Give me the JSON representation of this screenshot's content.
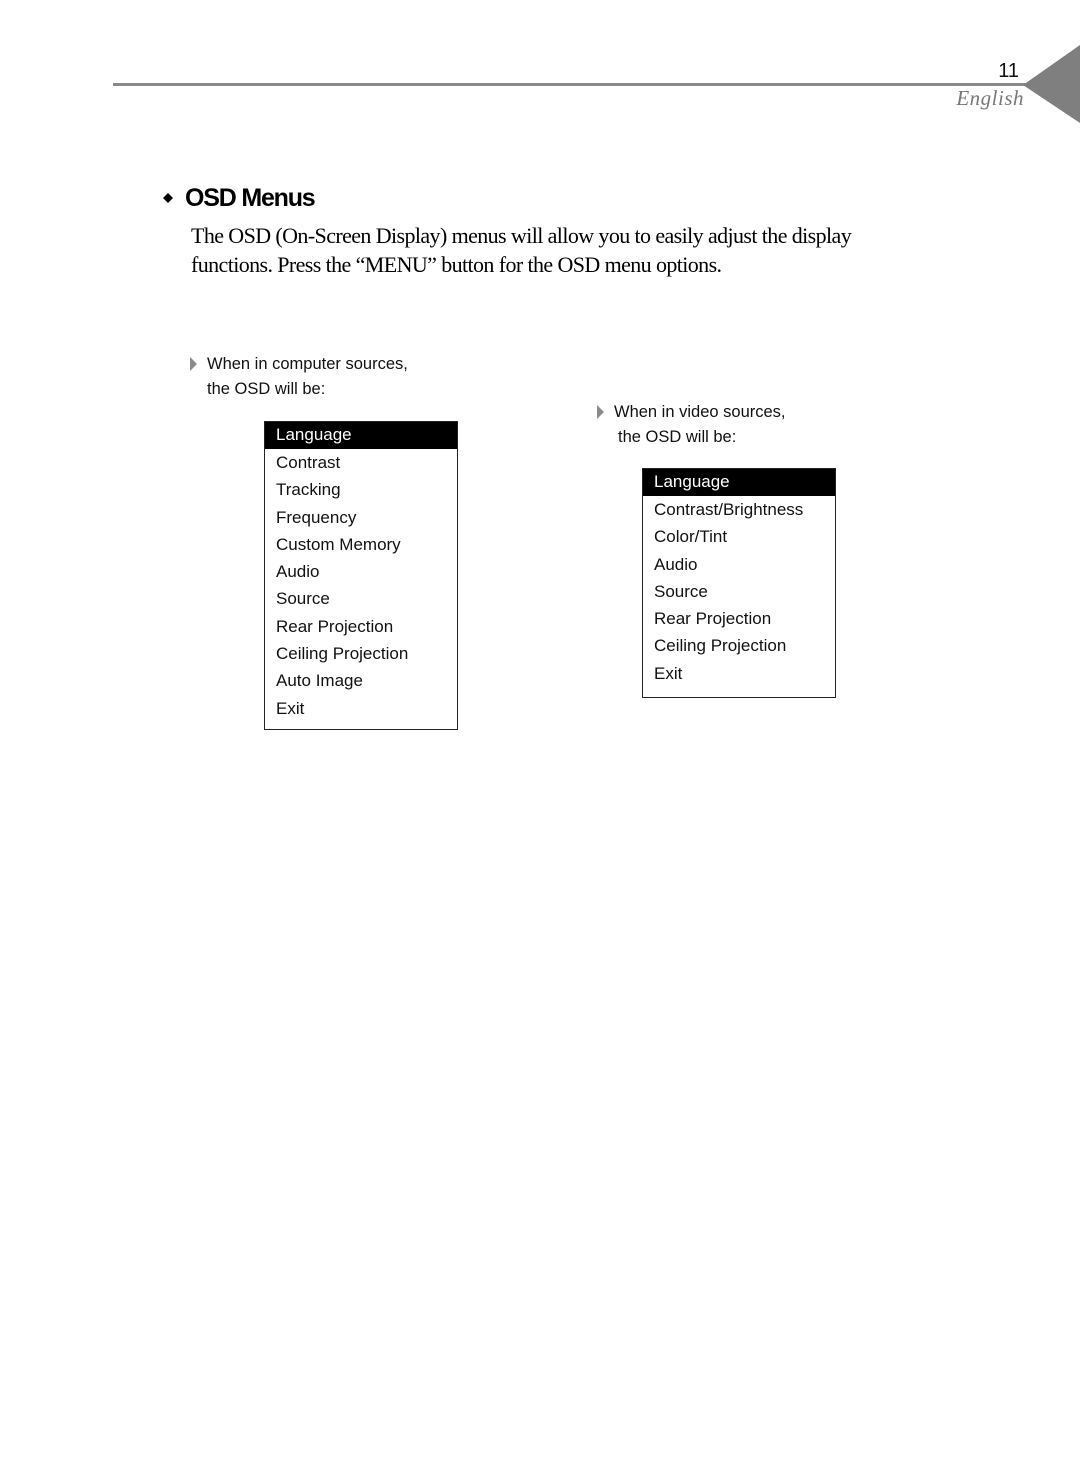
{
  "header": {
    "page_number": "11",
    "language": "English",
    "rule_color": "#8a8a8a",
    "tab_color": "#7f7f7f"
  },
  "section": {
    "bullet_icon": "diamond-icon",
    "title": "OSD Menus",
    "intro_line1": "The OSD (On-Screen Display) menus will allow you to easily adjust the display",
    "intro_line2": "functions.  Press the “MENU” button for the OSD menu options."
  },
  "computer_sources": {
    "arrow_icon": "triangle-right-icon",
    "caption_line1": "When in computer sources,",
    "caption_line2": "the OSD will be:",
    "menu": {
      "selected": "Language",
      "items": [
        "Language",
        "Contrast",
        "Tracking",
        "Frequency",
        "Custom Memory",
        "Audio",
        "Source",
        "Rear Projection",
        "Ceiling Projection",
        "Auto Image",
        "Exit"
      ]
    }
  },
  "video_sources": {
    "arrow_icon": "triangle-right-icon",
    "caption_line1": "When in video sources,",
    "caption_line2": "the OSD will be:",
    "menu": {
      "selected": "Language",
      "items": [
        "Language",
        "Contrast/Brightness",
        "Color/Tint",
        "Audio",
        "Source",
        "Rear Projection",
        "Ceiling Projection",
        "Exit"
      ]
    }
  }
}
